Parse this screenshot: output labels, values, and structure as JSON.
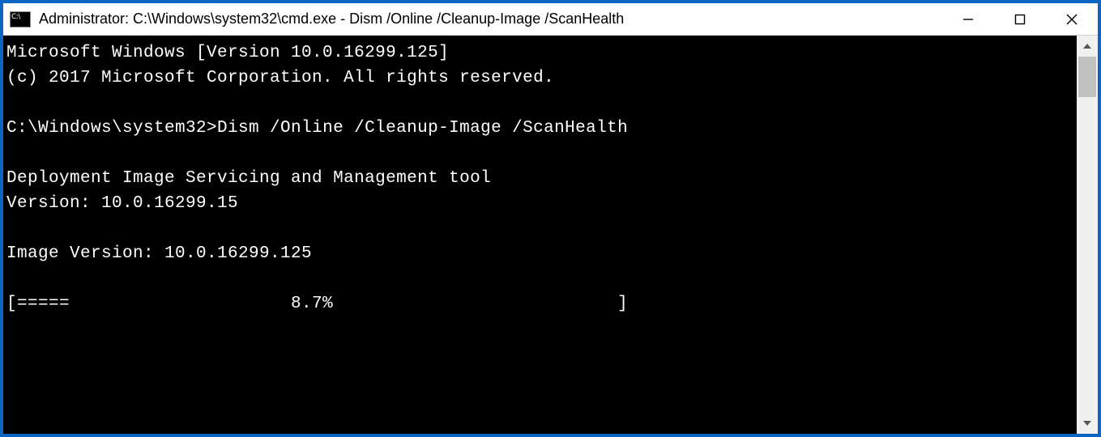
{
  "window": {
    "title": "Administrator: C:\\Windows\\system32\\cmd.exe - Dism  /Online /Cleanup-Image /ScanHealth"
  },
  "terminal": {
    "line1": "Microsoft Windows [Version 10.0.16299.125]",
    "line2": "(c) 2017 Microsoft Corporation. All rights reserved.",
    "blank": "",
    "prompt": "C:\\Windows\\system32>",
    "command": "Dism /Online /Cleanup-Image /ScanHealth",
    "tool_line": "Deployment Image Servicing and Management tool",
    "version_line": "Version: 10.0.16299.15",
    "image_version_line": "Image Version: 10.0.16299.125",
    "progress": "[=====                     8.7%                           ]"
  }
}
